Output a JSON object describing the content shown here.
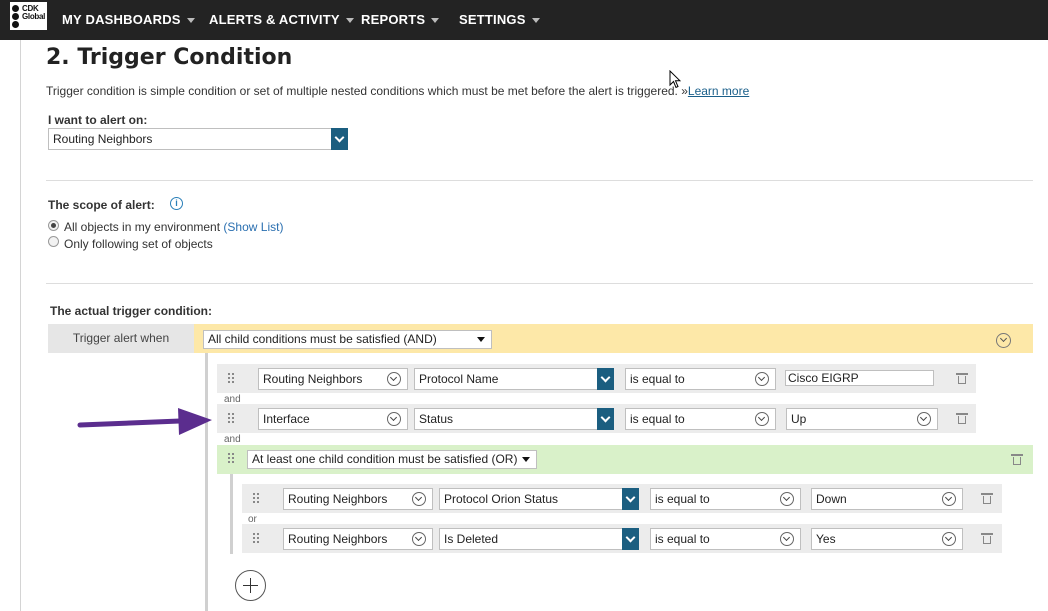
{
  "nav": {
    "logo_text": "CDK Global",
    "items": [
      {
        "label": "MY DASHBOARDS"
      },
      {
        "label": "ALERTS & ACTIVITY"
      },
      {
        "label": "REPORTS"
      },
      {
        "label": "SETTINGS"
      }
    ]
  },
  "section": {
    "title": "2. Trigger Condition",
    "description": "Trigger condition is simple condition or set of multiple nested conditions which must be met before the alert is triggered. »",
    "learn_more": "Learn more"
  },
  "alert_on": {
    "label": "I want to alert on:",
    "value": "Routing Neighbors"
  },
  "scope": {
    "label": "The scope of alert:",
    "options": [
      {
        "label": "All objects in my environment",
        "link": "(Show List)",
        "selected": true
      },
      {
        "label": "Only following set of objects",
        "selected": false
      }
    ]
  },
  "trigger": {
    "label": "The actual trigger condition:",
    "when_label": "Trigger alert when",
    "group_mode": "All child conditions must be satisfied (AND)",
    "conditions": [
      {
        "object": "Routing Neighbors",
        "property": "Protocol Name",
        "operator": "is equal to",
        "value": "Cisco EIGRP"
      },
      {
        "object": "Interface",
        "property": "Status",
        "operator": "is equal to",
        "value": "Up"
      }
    ],
    "conjunction": "and",
    "nested_group": {
      "mode": "At least one child condition must be satisfied (OR)",
      "conjunction": "or",
      "conditions": [
        {
          "object": "Routing Neighbors",
          "property": "Protocol Orion Status",
          "operator": "is equal to",
          "value": "Down"
        },
        {
          "object": "Routing Neighbors",
          "property": "Is Deleted",
          "operator": "is equal to",
          "value": "Yes"
        }
      ]
    }
  },
  "colors": {
    "nav_bg": "#232323",
    "and_band": "#fde8a8",
    "or_band": "#d9f1c9",
    "dropdown_button": "#1b5e80",
    "arrow": "#5b2d8e",
    "link": "#1a5f8a"
  },
  "icons": [
    "info-icon",
    "grip-icon",
    "trash-icon",
    "chevron-down-icon",
    "add-icon",
    "cursor-icon",
    "arrow-annotation"
  ]
}
